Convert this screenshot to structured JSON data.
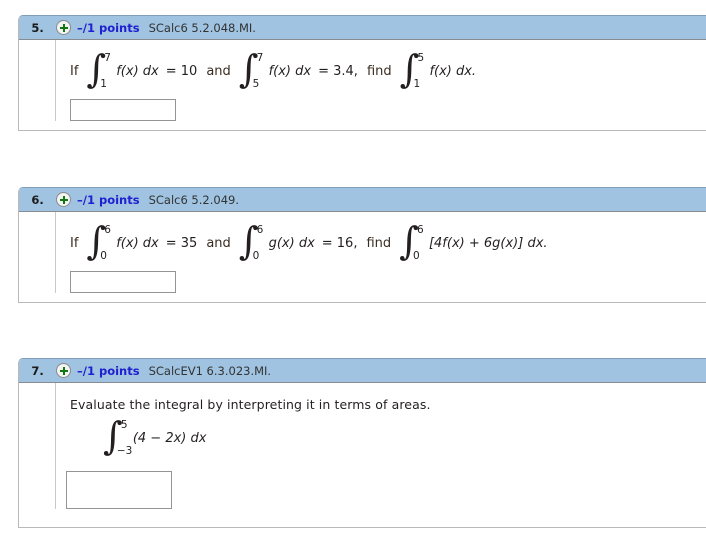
{
  "page": {
    "background_color": "#ffffff",
    "header_color": "#9fc3e0",
    "points_color": "#2020d0",
    "plus_icon_color": "#117711"
  },
  "problems": [
    {
      "number": "5.",
      "expand_icon": "plus-circle-icon",
      "points": "–/1 points",
      "problem_id": "SCalc6 5.2.048.MI.",
      "prompt": "",
      "statement": {
        "lead": "If",
        "integral1": {
          "lower": "1",
          "upper": "7",
          "body": "f(x) dx"
        },
        "equals1": "= 10",
        "conj": "and",
        "integral2": {
          "lower": "5",
          "upper": "7",
          "body": "f(x) dx"
        },
        "equals2": "= 3.4,",
        "find": "find",
        "integral3": {
          "lower": "1",
          "upper": "5",
          "body": "f(x) dx."
        }
      },
      "answer": {
        "value": "",
        "placeholder": "",
        "size": "short"
      }
    },
    {
      "number": "6.",
      "expand_icon": "plus-circle-icon",
      "points": "–/1 points",
      "problem_id": "SCalc6 5.2.049.",
      "prompt": "",
      "statement": {
        "lead": "If",
        "integral1": {
          "lower": "0",
          "upper": "6",
          "body": "f(x) dx"
        },
        "equals1": "= 35",
        "conj": "and",
        "integral2": {
          "lower": "0",
          "upper": "6",
          "body": "g(x) dx"
        },
        "equals2": "= 16,",
        "find": "find",
        "integral3": {
          "lower": "0",
          "upper": "6",
          "body": "[4f(x) + 6g(x)] dx."
        }
      },
      "answer": {
        "value": "",
        "placeholder": "",
        "size": "short"
      }
    },
    {
      "number": "7.",
      "expand_icon": "plus-circle-icon",
      "points": "–/1 points",
      "problem_id": "SCalcEV1 6.3.023.MI.",
      "prompt": "Evaluate the integral by interpreting it in terms of areas.",
      "statement": {
        "integral1": {
          "lower": "−3",
          "upper": "5",
          "body": "(4 − 2x) dx"
        }
      },
      "answer": {
        "value": "",
        "placeholder": "",
        "size": "tall"
      }
    }
  ]
}
